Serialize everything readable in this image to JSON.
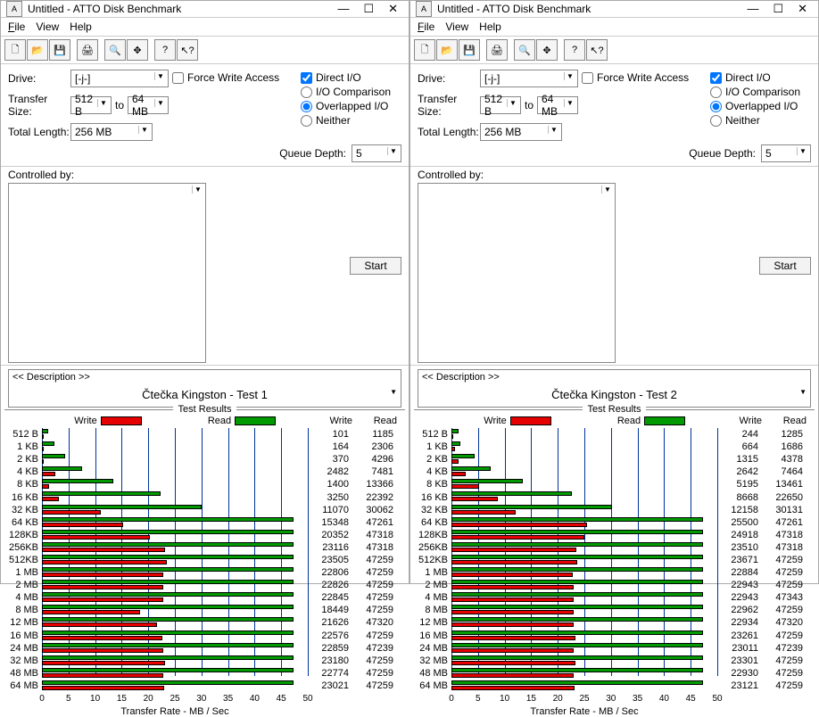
{
  "windows": [
    {
      "title": "Untitled - ATTO Disk Benchmark",
      "menu": {
        "file": "File",
        "view": "View",
        "help": "Help"
      },
      "settings": {
        "drive_label": "Drive:",
        "drive_value": "[-j-]",
        "transfer_label": "Transfer Size:",
        "transfer_from": "512 B",
        "transfer_to_word": "to",
        "transfer_to": "64 MB",
        "total_label": "Total Length:",
        "total_value": "256 MB",
        "force_write": "Force Write Access",
        "direct_io": "Direct I/O",
        "io_comp": "I/O Comparison",
        "overlapped": "Overlapped I/O",
        "neither": "Neither",
        "queue_label": "Queue Depth:",
        "queue_value": "5",
        "controlled_label": "Controlled by:",
        "start": "Start",
        "desc_hdr": "<< Description >>",
        "desc_body": "Čtečka Kingston - Test 1"
      },
      "results_title": "Test Results",
      "legend": {
        "write": "Write",
        "read": "Read",
        "write_col": "Write",
        "read_col": "Read"
      },
      "axis_title": "Transfer Rate - MB / Sec",
      "rows": [
        {
          "label": "512 B",
          "write": 101,
          "read": 1185
        },
        {
          "label": "1 KB",
          "write": 164,
          "read": 2306
        },
        {
          "label": "2 KB",
          "write": 370,
          "read": 4296
        },
        {
          "label": "4 KB",
          "write": 2482,
          "read": 7481
        },
        {
          "label": "8 KB",
          "write": 1400,
          "read": 13366
        },
        {
          "label": "16 KB",
          "write": 3250,
          "read": 22392
        },
        {
          "label": "32 KB",
          "write": 11070,
          "read": 30062
        },
        {
          "label": "64 KB",
          "write": 15348,
          "read": 47261
        },
        {
          "label": "128KB",
          "write": 20352,
          "read": 47318
        },
        {
          "label": "256KB",
          "write": 23116,
          "read": 47318
        },
        {
          "label": "512KB",
          "write": 23505,
          "read": 47259
        },
        {
          "label": "1 MB",
          "write": 22806,
          "read": 47259
        },
        {
          "label": "2 MB",
          "write": 22826,
          "read": 47259
        },
        {
          "label": "4 MB",
          "write": 22845,
          "read": 47259
        },
        {
          "label": "8 MB",
          "write": 18449,
          "read": 47259
        },
        {
          "label": "12 MB",
          "write": 21626,
          "read": 47320
        },
        {
          "label": "16 MB",
          "write": 22576,
          "read": 47259
        },
        {
          "label": "24 MB",
          "write": 22859,
          "read": 47239
        },
        {
          "label": "32 MB",
          "write": 23180,
          "read": 47259
        },
        {
          "label": "48 MB",
          "write": 22774,
          "read": 47259
        },
        {
          "label": "64 MB",
          "write": 23021,
          "read": 47259
        }
      ]
    },
    {
      "title": "Untitled - ATTO Disk Benchmark",
      "menu": {
        "file": "File",
        "view": "View",
        "help": "Help"
      },
      "settings": {
        "drive_label": "Drive:",
        "drive_value": "[-j-]",
        "transfer_label": "Transfer Size:",
        "transfer_from": "512 B",
        "transfer_to_word": "to",
        "transfer_to": "64 MB",
        "total_label": "Total Length:",
        "total_value": "256 MB",
        "force_write": "Force Write Access",
        "direct_io": "Direct I/O",
        "io_comp": "I/O Comparison",
        "overlapped": "Overlapped I/O",
        "neither": "Neither",
        "queue_label": "Queue Depth:",
        "queue_value": "5",
        "controlled_label": "Controlled by:",
        "start": "Start",
        "desc_hdr": "<< Description >>",
        "desc_body": "Čtečka Kingston - Test 2"
      },
      "results_title": "Test Results",
      "legend": {
        "write": "Write",
        "read": "Read",
        "write_col": "Write",
        "read_col": "Read"
      },
      "axis_title": "Transfer Rate - MB / Sec",
      "rows": [
        {
          "label": "512 B",
          "write": 244,
          "read": 1285
        },
        {
          "label": "1 KB",
          "write": 664,
          "read": 1686
        },
        {
          "label": "2 KB",
          "write": 1315,
          "read": 4378
        },
        {
          "label": "4 KB",
          "write": 2642,
          "read": 7464
        },
        {
          "label": "8 KB",
          "write": 5195,
          "read": 13461
        },
        {
          "label": "16 KB",
          "write": 8668,
          "read": 22650
        },
        {
          "label": "32 KB",
          "write": 12158,
          "read": 30131
        },
        {
          "label": "64 KB",
          "write": 25500,
          "read": 47261
        },
        {
          "label": "128KB",
          "write": 24918,
          "read": 47318
        },
        {
          "label": "256KB",
          "write": 23510,
          "read": 47318
        },
        {
          "label": "512KB",
          "write": 23671,
          "read": 47259
        },
        {
          "label": "1 MB",
          "write": 22884,
          "read": 47259
        },
        {
          "label": "2 MB",
          "write": 22943,
          "read": 47259
        },
        {
          "label": "4 MB",
          "write": 22943,
          "read": 47343
        },
        {
          "label": "8 MB",
          "write": 22962,
          "read": 47259
        },
        {
          "label": "12 MB",
          "write": 22934,
          "read": 47320
        },
        {
          "label": "16 MB",
          "write": 23261,
          "read": 47259
        },
        {
          "label": "24 MB",
          "write": 23011,
          "read": 47239
        },
        {
          "label": "32 MB",
          "write": 23301,
          "read": 47259
        },
        {
          "label": "48 MB",
          "write": 22930,
          "read": 47259
        },
        {
          "label": "64 MB",
          "write": 23121,
          "read": 47259
        }
      ]
    }
  ],
  "chart_data": [
    {
      "type": "bar",
      "title": "Test Results (Test 1)",
      "xlabel": "Transfer Rate - MB / Sec",
      "ylabel": "",
      "xlim": [
        0,
        50
      ],
      "categories": [
        "512 B",
        "1 KB",
        "2 KB",
        "4 KB",
        "8 KB",
        "16 KB",
        "32 KB",
        "64 KB",
        "128KB",
        "256KB",
        "512KB",
        "1 MB",
        "2 MB",
        "4 MB",
        "8 MB",
        "12 MB",
        "16 MB",
        "24 MB",
        "32 MB",
        "48 MB",
        "64 MB"
      ],
      "series": [
        {
          "name": "Write",
          "values": [
            101,
            164,
            370,
            2482,
            1400,
            3250,
            11070,
            15348,
            20352,
            23116,
            23505,
            22806,
            22826,
            22845,
            18449,
            21626,
            22576,
            22859,
            23180,
            22774,
            23021
          ]
        },
        {
          "name": "Read",
          "values": [
            1185,
            2306,
            4296,
            7481,
            13366,
            22392,
            30062,
            47261,
            47318,
            47318,
            47259,
            47259,
            47259,
            47259,
            47259,
            47320,
            47259,
            47239,
            47259,
            47259,
            47259
          ]
        }
      ]
    },
    {
      "type": "bar",
      "title": "Test Results (Test 2)",
      "xlabel": "Transfer Rate - MB / Sec",
      "ylabel": "",
      "xlim": [
        0,
        50
      ],
      "categories": [
        "512 B",
        "1 KB",
        "2 KB",
        "4 KB",
        "8 KB",
        "16 KB",
        "32 KB",
        "64 KB",
        "128KB",
        "256KB",
        "512KB",
        "1 MB",
        "2 MB",
        "4 MB",
        "8 MB",
        "12 MB",
        "16 MB",
        "24 MB",
        "32 MB",
        "48 MB",
        "64 MB"
      ],
      "series": [
        {
          "name": "Write",
          "values": [
            244,
            664,
            1315,
            2642,
            5195,
            8668,
            12158,
            25500,
            24918,
            23510,
            23671,
            22884,
            22943,
            22943,
            22962,
            22934,
            23261,
            23011,
            23301,
            22930,
            23121
          ]
        },
        {
          "name": "Read",
          "values": [
            1285,
            1686,
            4378,
            7464,
            13461,
            22650,
            30131,
            47261,
            47318,
            47318,
            47259,
            47259,
            47259,
            47343,
            47259,
            47320,
            47259,
            47239,
            47259,
            47259,
            47259
          ]
        }
      ]
    }
  ],
  "axis_ticks": [
    0,
    5,
    10,
    15,
    20,
    25,
    30,
    35,
    40,
    45,
    50
  ]
}
